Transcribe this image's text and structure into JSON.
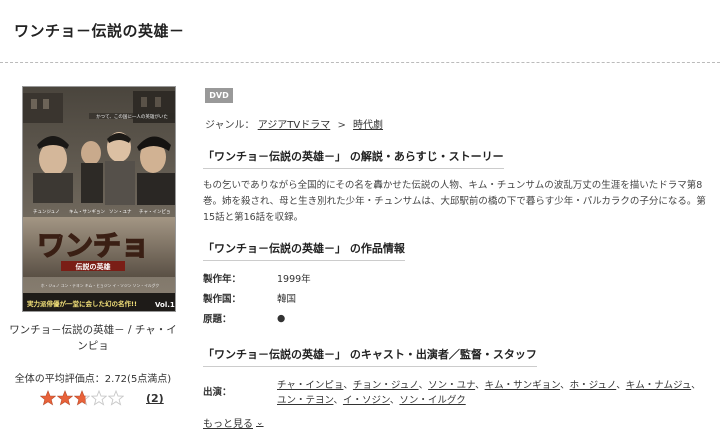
{
  "page": {
    "title": "ワンチョ－伝説の英雄－"
  },
  "cover": {
    "tagline": "かつて、この国に一人の英雄がいた",
    "cast_names": [
      "チュンジュノ",
      "キム・サンギョン",
      "ソン・ユナ",
      "チャ・インピョ"
    ],
    "title": "ワンチョ",
    "subtitle": "伝説の英雄",
    "bottom_names": "ホ・ジュノ  ユン・テヨン  キム・ヒョジン  イ・ソジン  ソン・イルグク",
    "banner": "実力派俳優が一堂に会した幻の名作!!",
    "vol": "Vol.1"
  },
  "left": {
    "caption": "ワンチョ－伝説の英雄－ / チャ・インピョ",
    "rating_label": "全体の平均評価点：2.72(5点満点)",
    "rating_value": 2.72,
    "rating_max": 5,
    "review_count": "(2)"
  },
  "badge": "DVD",
  "genre": {
    "label": "ジャンル：",
    "items": [
      "アジアTVドラマ",
      "時代劇"
    ],
    "separator": ">"
  },
  "sections": {
    "synopsis_head": "「ワンチョ－伝説の英雄－」 の解説・あらすじ・ストーリー",
    "synopsis": "もの乞いでありながら全国的にその名を轟かせた伝説の人物、キム・チュンサムの波乱万丈の生涯を描いたドラマ第8巻。姉を殺され、母と生き別れた少年・チュンサムは、大邱駅前の橋の下で暮らす少年・パルカラクの子分になる。第15話と第16話を収録。",
    "info_head": "「ワンチョ－伝説の英雄－」 の作品情報",
    "cast_head": "「ワンチョ－伝説の英雄－」 のキャスト・出演者／監督・スタッフ"
  },
  "info": [
    {
      "key": "製作年：",
      "value": "1999年"
    },
    {
      "key": "製作国：",
      "value": "韓国"
    },
    {
      "key": "原題：",
      "value": "●"
    }
  ],
  "cast": {
    "key": "出演：",
    "names": [
      "チャ・インピョ",
      "チョン・ジュノ",
      "ソン・ユナ",
      "キム・サンギョン",
      "ホ・ジュノ",
      "キム・ナムジュ",
      "ユン・テヨン",
      "イ・ソジン",
      "ソン・イルグク"
    ],
    "separator": "、"
  },
  "more": {
    "label": "もっと見る",
    "icon": "chevron-down-icon"
  },
  "colors": {
    "star_filled": "#e8623a",
    "star_empty": "#c8c8c8",
    "badge_bg": "#999999"
  }
}
